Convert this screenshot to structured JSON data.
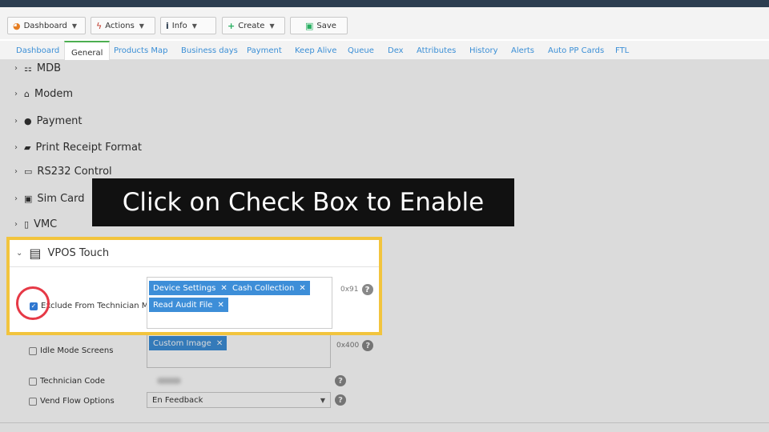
{
  "toolbar": {
    "buttons": [
      {
        "label": "Dashboard",
        "icon": "pie-chart-icon"
      },
      {
        "label": "Actions",
        "icon": "lightning-icon"
      },
      {
        "label": "Info",
        "icon": "info-icon"
      },
      {
        "label": "Create",
        "icon": "plus-icon"
      },
      {
        "label": "Save",
        "icon": "floppy-icon"
      }
    ]
  },
  "tabs": [
    {
      "label": "Dashboard"
    },
    {
      "label": "General"
    },
    {
      "label": "Products Map"
    },
    {
      "label": "Business days"
    },
    {
      "label": "Payment"
    },
    {
      "label": "Keep Alive"
    },
    {
      "label": "Queue"
    },
    {
      "label": "Dex"
    },
    {
      "label": "Attributes"
    },
    {
      "label": "History"
    },
    {
      "label": "Alerts"
    },
    {
      "label": "Auto PP Cards"
    },
    {
      "label": "FTL"
    }
  ],
  "active_tab": "General",
  "sections": [
    {
      "label": "MDB",
      "icon": "mdb-icon"
    },
    {
      "label": "Modem",
      "icon": "modem-icon"
    },
    {
      "label": "Payment",
      "icon": "dollar-icon"
    },
    {
      "label": "Print Receipt Format",
      "icon": "printer-icon"
    },
    {
      "label": "RS232 Control",
      "icon": "serial-port-icon"
    },
    {
      "label": "Sim Card",
      "icon": "sim-card-icon"
    },
    {
      "label": "VMC",
      "icon": "vmc-icon"
    }
  ],
  "caption": "Click on Check Box to Enable",
  "vpos": {
    "title": "VPOS Touch",
    "exclude_label": "Exclude From Technician Menu",
    "exclude_checked": true,
    "exclude_tags": [
      "Device Settings",
      "Cash Collection",
      "Read Audit File"
    ],
    "exclude_hex": "0x91",
    "idle_label": "Idle Mode Screens",
    "idle_tags": [
      "Custom Image"
    ],
    "idle_hex": "0x400",
    "tech_label": "Technician Code",
    "vend_label": "Vend Flow Options",
    "vend_value": "En Feedback"
  },
  "colors": {
    "accent_tab": "#4caf50",
    "link": "#3b8fd6",
    "tag": "#3d8ed8",
    "highlight": "#f2c43d",
    "circle": "#e63946"
  }
}
